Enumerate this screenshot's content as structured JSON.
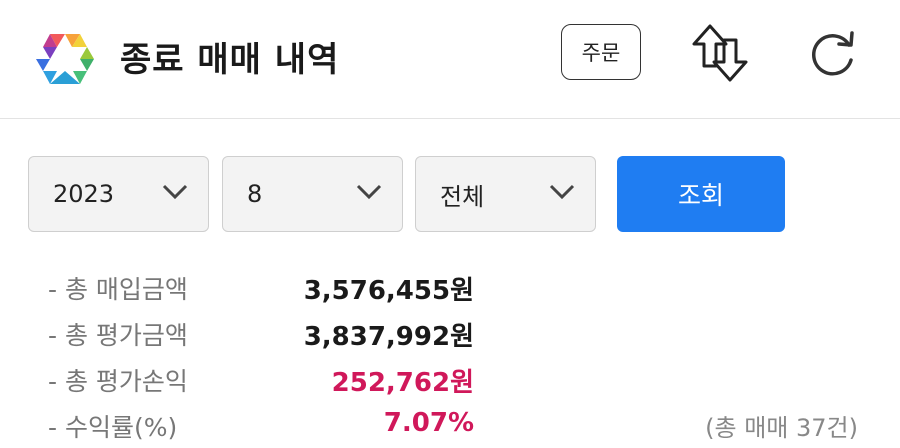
{
  "header": {
    "title": "종료 매매 내역",
    "order_label": "주문"
  },
  "filters": {
    "year": "2023",
    "month": "8",
    "type": "전체",
    "search_label": "조회"
  },
  "summary": [
    {
      "label": "- 총 매입금액",
      "value": "3,576,455원",
      "highlight": false
    },
    {
      "label": "- 총 평가금액",
      "value": "3,837,992원",
      "highlight": false
    },
    {
      "label": "- 총 평가손익",
      "value": "252,762원",
      "highlight": true
    },
    {
      "label": "- 수익률(%)",
      "value": "7.07%",
      "highlight": true
    }
  ],
  "trade_count": "(총 매매 37건)",
  "colors": {
    "accent": "#1f7df2",
    "profit": "#d0185a"
  },
  "icons": [
    "app-logo-icon",
    "swap-arrows-icon",
    "refresh-icon",
    "chevron-down-icon"
  ]
}
